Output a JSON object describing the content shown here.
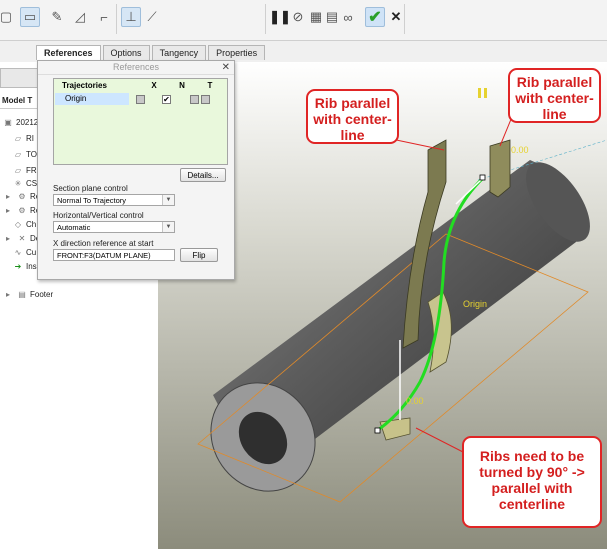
{
  "tabs": [
    "References",
    "Options",
    "Tangency",
    "Properties"
  ],
  "tree": {
    "header": "Model T",
    "items": [
      {
        "label": "20212",
        "icon": "part-icon"
      },
      {
        "label": "RI",
        "icon": "datum-plane-icon"
      },
      {
        "label": "TO",
        "icon": "datum-plane-icon"
      },
      {
        "label": "FR",
        "icon": "datum-plane-icon"
      },
      {
        "label": "CS",
        "icon": "csys-icon"
      },
      {
        "label": "Re",
        "icon": "feature-icon"
      },
      {
        "label": "Re",
        "icon": "feature-icon"
      },
      {
        "label": "Ch",
        "icon": "feature-icon"
      },
      {
        "label": "De",
        "icon": "feature-icon"
      },
      {
        "label": "Cu",
        "icon": "curve-icon"
      },
      {
        "label": "Ins",
        "icon": "insert-arrow-icon"
      },
      {
        "label": "Footer",
        "icon": "footer-icon"
      }
    ]
  },
  "panel": {
    "title": "References",
    "trajectories_header": "Trajectories",
    "cols": [
      "X",
      "N",
      "T"
    ],
    "trajectory_row": "Origin",
    "details_button": "Details...",
    "section_plane_label": "Section plane control",
    "section_plane_value": "Normal To Trajectory",
    "hv_label": "Horizontal/Vertical control",
    "hv_value": "Automatic",
    "xdir_label": "X direction reference at start",
    "xdir_value": "FRONT:F3(DATUM PLANE)",
    "flip_button": "Flip"
  },
  "viewport": {
    "dim_top": "0.00",
    "dim_bottom": "0.00",
    "origin_label": "Origin"
  },
  "callouts": {
    "left": "Rib parallel with center-line",
    "right": "Rib parallel with center-line",
    "bottom": "Ribs need to be turned by 90° -> parallel with centerline"
  },
  "colors": {
    "accent": "#e02525",
    "trajectory": "#22dd22",
    "selection": "#cde6ff",
    "confirm": "#2aa02a"
  }
}
